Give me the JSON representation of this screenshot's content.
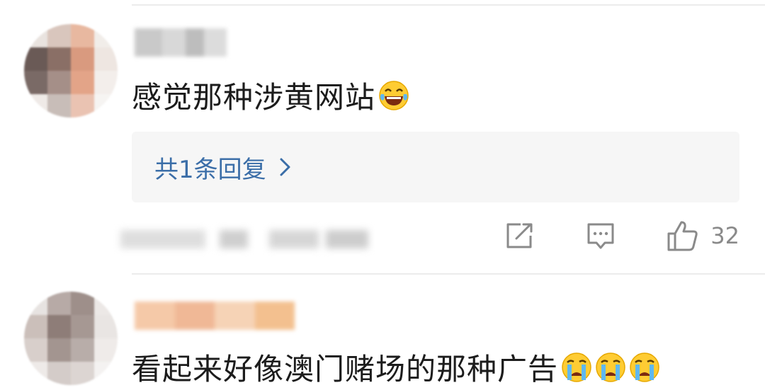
{
  "comments": [
    {
      "text": "感觉那种涉黄网站",
      "emoji": [
        "laughing-crying-emoji"
      ],
      "reply_link": "共1条回复",
      "like_count": "32"
    },
    {
      "text": "看起来好像澳门赌场的那种广告",
      "emoji": [
        "crying-emoji",
        "crying-emoji",
        "crying-emoji"
      ]
    }
  ],
  "icons": {
    "share": "share-icon",
    "comment": "comment-icon",
    "like": "thumbs-up-icon"
  },
  "colors": {
    "link": "#3b6ea8",
    "text": "#1c1c1c",
    "muted": "#8a8a8a",
    "reply_bg": "#f6f6f6"
  }
}
